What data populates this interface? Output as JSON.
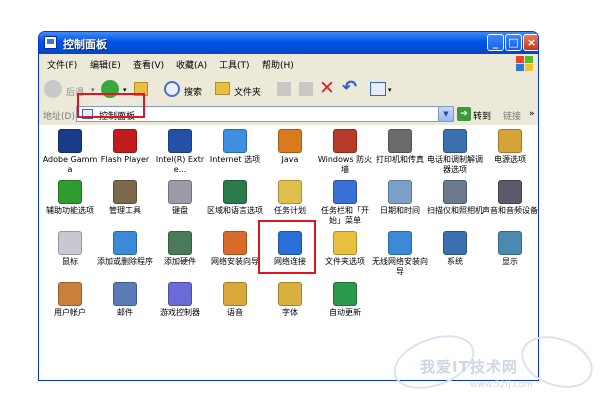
{
  "window": {
    "title": "控制面板",
    "controls": [
      "_",
      "□",
      "×"
    ]
  },
  "menu": [
    "文件(F)",
    "编辑(E)",
    "查看(V)",
    "收藏(A)",
    "工具(T)",
    "帮助(H)"
  ],
  "toolbar": {
    "back": "后退",
    "search": "搜索",
    "folders": "文件夹"
  },
  "address": {
    "label": "地址(D)",
    "value": "控制面板",
    "go": "转到",
    "links": "链接"
  },
  "items": [
    "Adobe Gamma",
    "Flash Player",
    "Intel(R) Extre...",
    "Internet 选项",
    "Java",
    "Windows 防火墙",
    "打印机和传真",
    "电话和调制解调器选项",
    "电源选项",
    "辅助功能选项",
    "管理工具",
    "键盘",
    "区域和语言选项",
    "任务计划",
    "任务栏和「开始」菜单",
    "日期和时间",
    "扫描仪和照相机",
    "声音和音频设备",
    "鼠标",
    "添加或删除程序",
    "添加硬件",
    "网络安装向导",
    "网络连接",
    "文件夹选项",
    "无线网络安装向导",
    "系统",
    "显示",
    "用户帐户",
    "邮件",
    "游戏控制器",
    "语音",
    "字体",
    "自动更新"
  ],
  "icon_names": [
    "monitor-icon",
    "flash-icon",
    "intel-icon",
    "internet-globe-icon",
    "java-icon",
    "firewall-icon",
    "printer-icon",
    "phone-modem-icon",
    "power-icon",
    "accessibility-icon",
    "admin-tools-icon",
    "keyboard-icon",
    "globe-clock-icon",
    "task-folder-icon",
    "taskbar-icon",
    "clock-icon",
    "scanner-icon",
    "speaker-icon",
    "mouse-icon",
    "add-remove-programs-icon",
    "add-hardware-icon",
    "network-wizard-icon",
    "network-globe-icon",
    "folder-options-icon",
    "wireless-icon",
    "system-icon",
    "display-icon",
    "users-icon",
    "mail-icon",
    "gamepad-icon",
    "voice-icon",
    "fonts-folder-icon",
    "windows-update-icon"
  ],
  "icon_colors": [
    "#1b3a8a",
    "#c21c1c",
    "#2550a8",
    "#3d8fe0",
    "#d87a1f",
    "#b73a2a",
    "#6b6b6b",
    "#3a6fb0",
    "#d8a23a",
    "#2f9a2f",
    "#7a6a4a",
    "#9a9aa8",
    "#2a7a4a",
    "#e0c04a",
    "#3a6fd8",
    "#7aa0c8",
    "#6a7a8a",
    "#5a5a6a",
    "#c8c8d0",
    "#3a8ad8",
    "#4a7a5a",
    "#d86a2a",
    "#2a6fd8",
    "#e8c040",
    "#3a8ad8",
    "#3a6fb0",
    "#4a8ab0",
    "#c8803a",
    "#5a7ab8",
    "#6a6ad8",
    "#d8a83a",
    "#d8b040",
    "#2a9a4a"
  ],
  "watermark": {
    "main": "我爱IT技术网",
    "url": "www.52ij.com"
  }
}
